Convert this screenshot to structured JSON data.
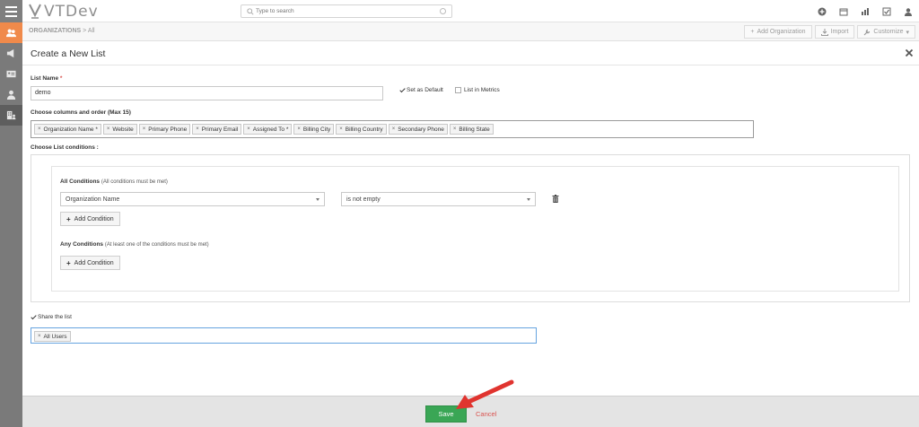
{
  "app": {
    "brand": "VTDev"
  },
  "search": {
    "placeholder": "Type to search"
  },
  "breadcrumb": {
    "module": "ORGANIZATIONS",
    "separator": ">",
    "current": "All"
  },
  "toolbar": {
    "add_label": "Add Organization",
    "import_label": "Import",
    "customize_label": "Customize"
  },
  "modal": {
    "title": "Create a New List",
    "list_name_label": "List Name",
    "list_name_required": "*",
    "list_name_value": "demo",
    "set_default_label": "Set as Default",
    "list_in_metrics_label": "List in Metrics",
    "columns_label": "Choose columns and order (Max 15)",
    "columns": [
      "Organization Name *",
      "Website",
      "Primary Phone",
      "Primary Email",
      "Assigned To *",
      "Billing City",
      "Billing Country",
      "Secondary Phone",
      "Billing State"
    ],
    "conditions_label": "Choose List conditions :",
    "all_conditions_title": "All Conditions",
    "all_conditions_note": "(All conditions must be met)",
    "condition_field": "Organization Name",
    "condition_operator": "is not empty",
    "add_condition_label": "Add Condition",
    "any_conditions_title": "Any Conditions",
    "any_conditions_note": "(At least one of the conditions must be met)",
    "share_label": "Share the list",
    "share_tags": [
      "All Users"
    ]
  },
  "footer": {
    "save_label": "Save",
    "cancel_label": "Cancel"
  },
  "colors": {
    "accent": "#f08a4b",
    "save": "#3aa655",
    "cancel": "#d9534f",
    "annotation_arrow": "#e0342f"
  }
}
